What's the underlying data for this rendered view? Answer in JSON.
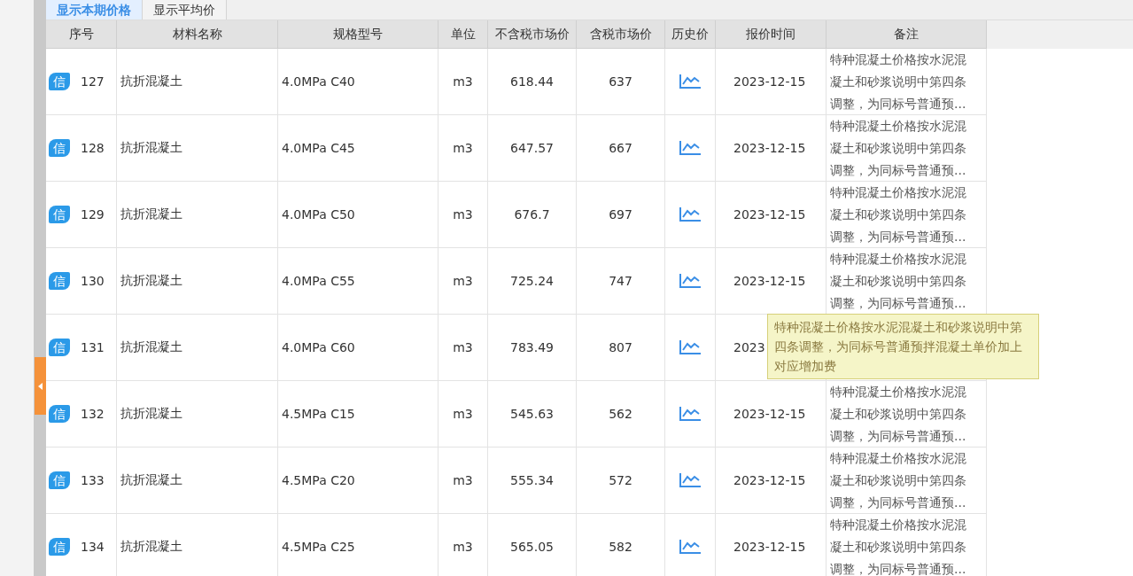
{
  "tabs": [
    {
      "label": "显示本期价格",
      "selected": true
    },
    {
      "label": "显示平均价",
      "selected": false
    }
  ],
  "table": {
    "columns": [
      "序号",
      "材料名称",
      "规格型号",
      "单位",
      "不含税市场价",
      "含税市场价",
      "历史价",
      "报价时间",
      "备注"
    ],
    "rows": [
      {
        "badge": "信",
        "index": "127",
        "name": "抗折混凝土",
        "spec": "4.0MPa C40",
        "unit": "m3",
        "price": "618.44",
        "tax_price": "637",
        "date": "2023-12-15",
        "remark": "特种混凝土价格按水泥混凝土和砂浆说明中第四条调整，为同标号普通预..."
      },
      {
        "badge": "信",
        "index": "128",
        "name": "抗折混凝土",
        "spec": "4.0MPa C45",
        "unit": "m3",
        "price": "647.57",
        "tax_price": "667",
        "date": "2023-12-15",
        "remark": "特种混凝土价格按水泥混凝土和砂浆说明中第四条调整，为同标号普通预..."
      },
      {
        "badge": "信",
        "index": "129",
        "name": "抗折混凝土",
        "spec": "4.0MPa C50",
        "unit": "m3",
        "price": "676.7",
        "tax_price": "697",
        "date": "2023-12-15",
        "remark": "特种混凝土价格按水泥混凝土和砂浆说明中第四条调整，为同标号普通预..."
      },
      {
        "badge": "信",
        "index": "130",
        "name": "抗折混凝土",
        "spec": "4.0MPa C55",
        "unit": "m3",
        "price": "725.24",
        "tax_price": "747",
        "date": "2023-12-15",
        "remark": "特种混凝土价格按水泥混凝土和砂浆说明中第四条调整，为同标号普通预..."
      },
      {
        "badge": "信",
        "index": "131",
        "name": "抗折混凝土",
        "spec": "4.0MPa C60",
        "unit": "m3",
        "price": "783.49",
        "tax_price": "807",
        "date": "2023"
      },
      {
        "badge": "信",
        "index": "132",
        "name": "抗折混凝土",
        "spec": "4.5MPa C15",
        "unit": "m3",
        "price": "545.63",
        "tax_price": "562",
        "date": "2023-12-15",
        "remark": "特种混凝土价格按水泥混凝土和砂浆说明中第四条调整，为同标号普通预..."
      },
      {
        "badge": "信",
        "index": "133",
        "name": "抗折混凝土",
        "spec": "4.5MPa C20",
        "unit": "m3",
        "price": "555.34",
        "tax_price": "572",
        "date": "2023-12-15",
        "remark": "特种混凝土价格按水泥混凝土和砂浆说明中第四条调整，为同标号普通预..."
      },
      {
        "badge": "信",
        "index": "134",
        "name": "抗折混凝土",
        "spec": "4.5MPa C25",
        "unit": "m3",
        "price": "565.05",
        "tax_price": "582",
        "date": "2023-12-15",
        "remark": "特种混凝土价格按水泥混凝土和砂浆说明中第四条调整，为同标号普通预..."
      }
    ]
  },
  "tooltip": "特种混凝土价格按水泥混凝土和砂浆说明中第四条调整，为同标号普通预拌混凝土单价加上对应增加费"
}
